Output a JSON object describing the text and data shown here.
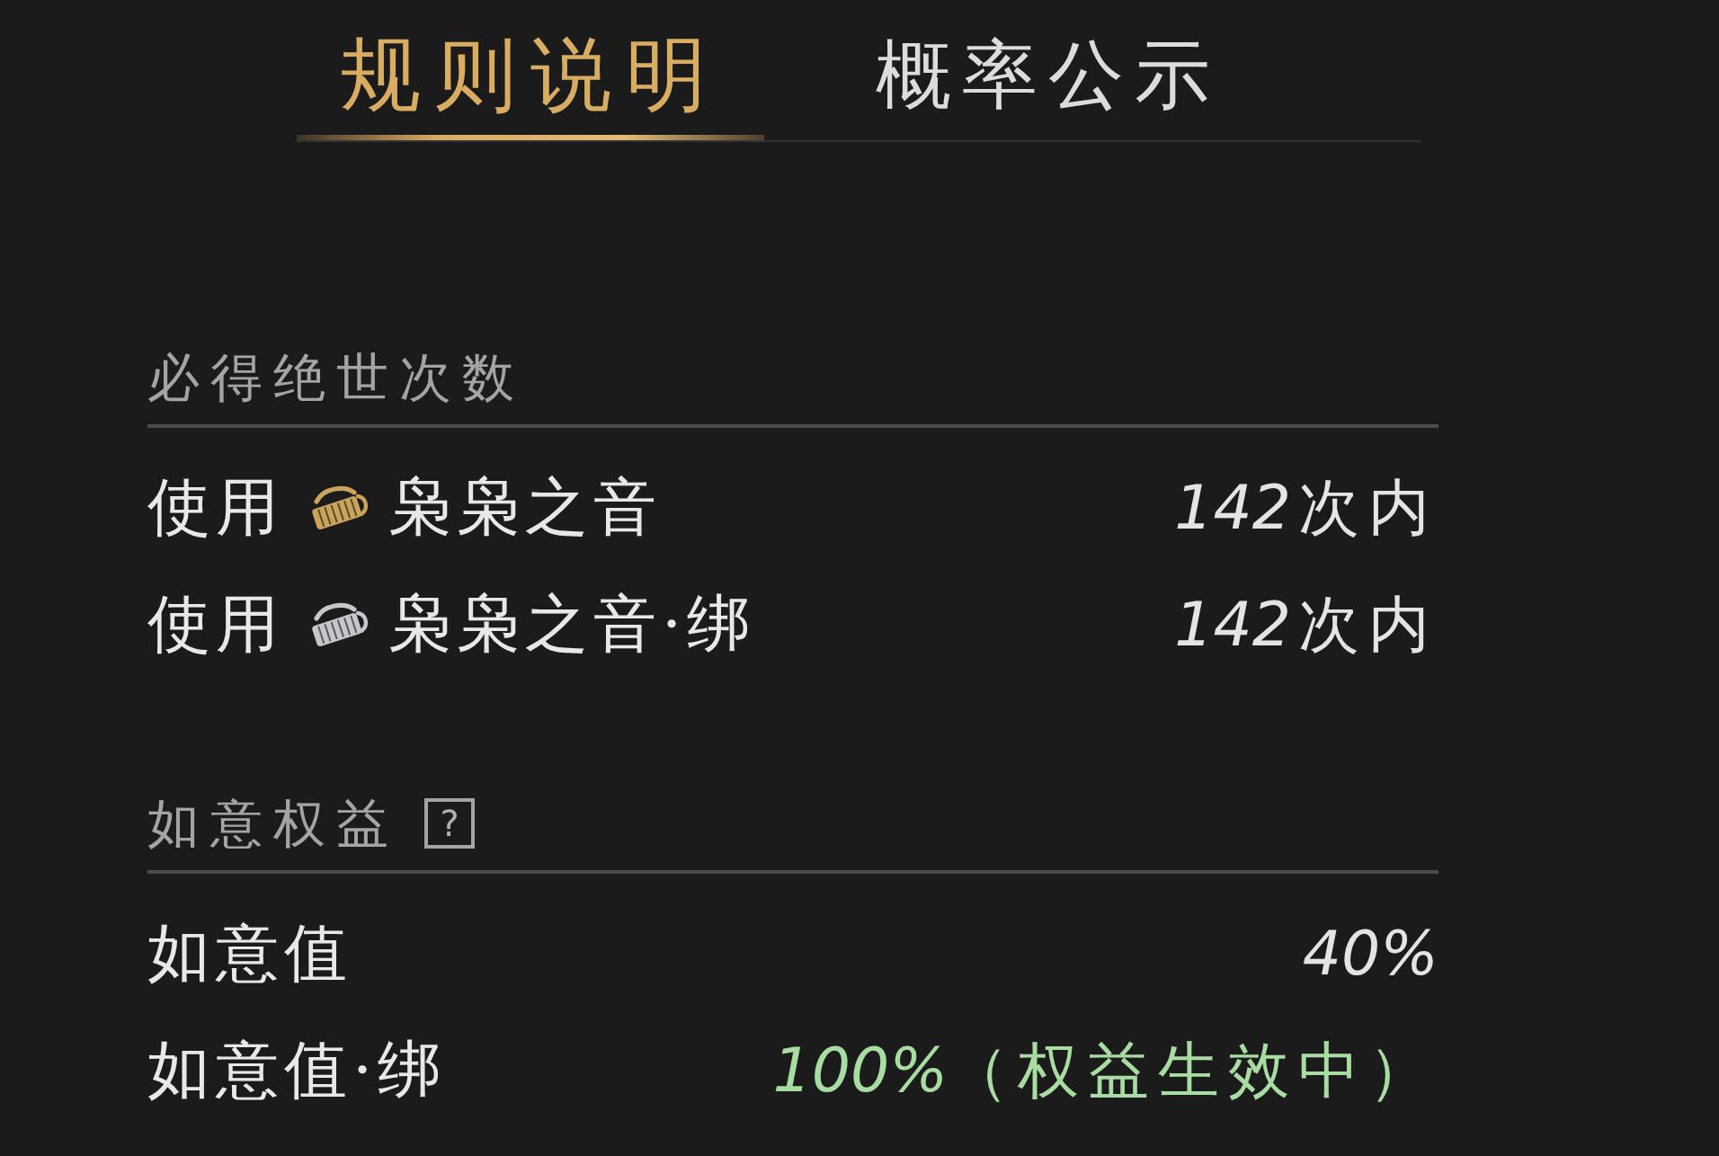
{
  "tabs": [
    {
      "label": "规则说明",
      "selected": true
    },
    {
      "label": "概率公示",
      "selected": false
    }
  ],
  "sections": [
    {
      "title": "必得绝世次数",
      "rows": [
        {
          "kind": "item",
          "prefix": "使用",
          "color": "#c9a45a",
          "item": "枭枭之音",
          "amount": "142",
          "suffix": "次内"
        },
        {
          "kind": "item",
          "prefix": "使用",
          "color": "#c4c8cc",
          "item": "枭枭之音·绑",
          "amount": "142",
          "suffix": "次内"
        }
      ]
    },
    {
      "title": "如意权益",
      "help": "?",
      "rows": [
        {
          "kind": "stat",
          "label": "如意值",
          "amount": "40%",
          "active": false
        },
        {
          "kind": "stat",
          "label": "如意值·绑",
          "amount": "100%",
          "suffix": "（权益生效中）",
          "active": true
        }
      ]
    }
  ]
}
